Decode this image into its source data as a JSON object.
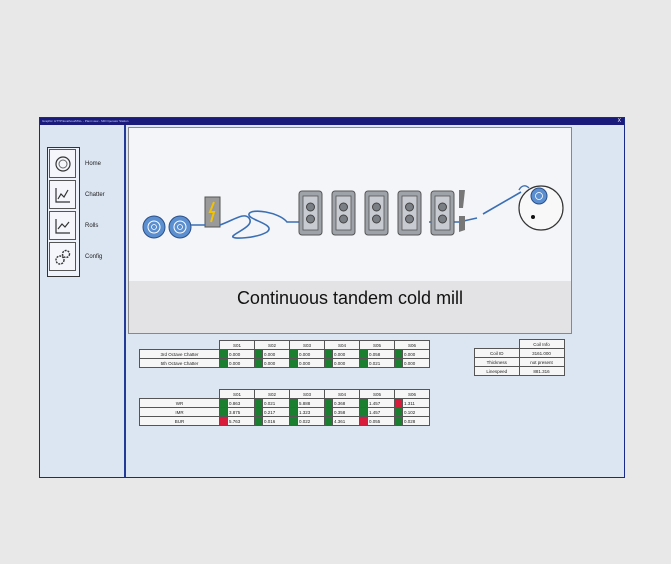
{
  "window": {
    "title": "Graphic: HTTP/localhost/MILL - Plant view - Mill Operator Station",
    "close_label": "X"
  },
  "nav": [
    {
      "label": "Home",
      "icon": "home-icon"
    },
    {
      "label": "Chatter",
      "icon": "chatter-chart-icon"
    },
    {
      "label": "Rolls",
      "icon": "rolls-chart-icon"
    },
    {
      "label": "Config",
      "icon": "gears-icon"
    }
  ],
  "mimic": {
    "caption": "Continuous tandem cold mill"
  },
  "chatter_table": {
    "columns": [
      "S01",
      "S02",
      "S03",
      "S04",
      "S05",
      "S06"
    ],
    "rows": [
      {
        "label": "3rd Octave Chatter",
        "values": [
          "0.000",
          "0.000",
          "0.000",
          "0.000",
          "0.058",
          "0.000"
        ],
        "status": [
          "green",
          "green",
          "green",
          "green",
          "green",
          "green"
        ]
      },
      {
        "label": "5th Octave Chatter",
        "values": [
          "0.000",
          "0.000",
          "0.000",
          "0.000",
          "0.021",
          "0.000"
        ],
        "status": [
          "green",
          "green",
          "green",
          "green",
          "green",
          "green"
        ]
      }
    ]
  },
  "coil_info": {
    "header": "Coil Info",
    "rows": [
      {
        "label": "Coil ID",
        "value": "3161.000"
      },
      {
        "label": "Thickness",
        "value": "not present"
      },
      {
        "label": "Linespeed",
        "value": "881.316"
      }
    ]
  },
  "rolls_table": {
    "columns": [
      "S01",
      "S02",
      "S03",
      "S04",
      "S05",
      "S06"
    ],
    "rows": [
      {
        "label": "WR",
        "values": [
          "0.863",
          "0.021",
          "5.888",
          "0.368",
          "1.457",
          "1.311"
        ],
        "status": [
          "green",
          "green",
          "green",
          "green",
          "green",
          "red"
        ]
      },
      {
        "label": "IMR",
        "values": [
          "3.875",
          "0.217",
          "1.323",
          "0.358",
          "1.457",
          "0.102"
        ],
        "status": [
          "green",
          "green",
          "green",
          "green",
          "green",
          "green"
        ]
      },
      {
        "label": "BUR",
        "values": [
          "5.763",
          "0.016",
          "0.022",
          "4.361",
          "0.055",
          "0.028"
        ],
        "status": [
          "red",
          "green",
          "green",
          "green",
          "red",
          "green"
        ]
      }
    ]
  },
  "colors": {
    "ok": "#1a7f2e",
    "alarm": "#d81b3a",
    "frame": "#243a98"
  }
}
